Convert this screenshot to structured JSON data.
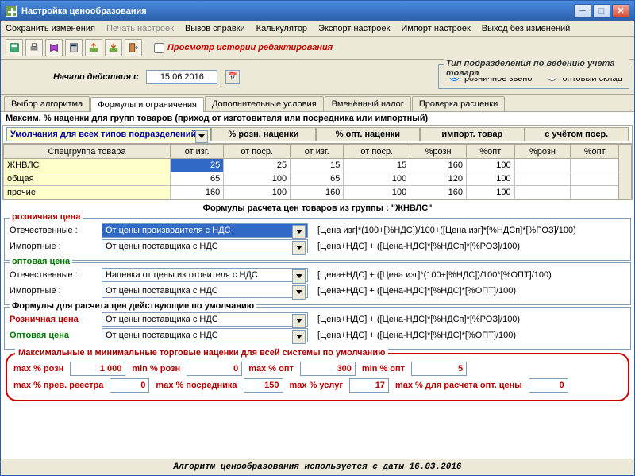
{
  "window": {
    "title": "Настройка ценообразования"
  },
  "menu": {
    "save": "Сохранить изменения",
    "print": "Печать настроек",
    "help": "Вызов справки",
    "calc": "Калькулятор",
    "export": "Экспорт настроек",
    "import": "Импорт настроек",
    "exit": "Выход без изменений"
  },
  "toolbar": {
    "history_label": "Просмотр истории редактирования"
  },
  "date": {
    "label": "Начало действия с",
    "value": "15.06.2016"
  },
  "dept_type": {
    "legend": "Тип подразделения по ведению учета товара",
    "retail": "розничное звено",
    "wholesale": "оптовый склад"
  },
  "tabs": {
    "t1": "Выбор алгоритма",
    "t2": "Формулы и ограничения",
    "t3": "Дополнительные условия",
    "t4": "Вменённый налог",
    "t5": "Проверка расценки"
  },
  "group_head": "Максим. % наценки для групп товаров (приход от изготовителя или посредника или импортный)",
  "combo_default": "Умолчания для всех типов подразделений",
  "hdr": {
    "retail_markup": "% розн. наценки",
    "wholesale_markup": "% опт. наценки",
    "import": "импорт. товар",
    "with_intermed": "с учётом поср."
  },
  "cols": {
    "c0": "Спецгруппа товара",
    "c1": "от изг.",
    "c2": "от поср.",
    "c3": "от изг.",
    "c4": "от поср.",
    "c5": "%розн",
    "c6": "%опт",
    "c7": "%розн",
    "c8": "%опт"
  },
  "rows": [
    {
      "name": "ЖНВЛС",
      "v1": "25",
      "v2": "25",
      "v3": "15",
      "v4": "15",
      "v5": "160",
      "v6": "100",
      "v7": "",
      "v8": ""
    },
    {
      "name": "общая",
      "v1": "65",
      "v2": "100",
      "v3": "65",
      "v4": "100",
      "v5": "120",
      "v6": "100",
      "v7": "",
      "v8": ""
    },
    {
      "name": "прочие",
      "v1": "160",
      "v2": "100",
      "v3": "160",
      "v4": "100",
      "v5": "160",
      "v6": "100",
      "v7": "",
      "v8": ""
    }
  ],
  "section_title": "Формулы расчета цен товаров из группы : \"ЖНВЛС\"",
  "retail_price": {
    "legend": "розничная цена",
    "dom_label": "Отечественные :",
    "dom_combo": "От цены производителя с НДС",
    "dom_formula": "[Цена изг]*(100+[%НДС])/100+([Цена изг]*[%НДСп]*[%РОЗ]/100)",
    "imp_label": "Импортные :",
    "imp_combo": "От цены поставщика с НДС",
    "imp_formula": "[Цена+НДС] + ([Цена-НДС]*[%НДСп]*[%РОЗ]/100)"
  },
  "wholesale_price": {
    "legend": "оптовая цена",
    "dom_label": "Отечественные :",
    "dom_combo": "Наценка от цены изготовителя с НДС",
    "dom_formula": "[Цена+НДС] + ([Цена изг]*(100+[%НДС])/100*[%ОПТ]/100)",
    "imp_label": "Импортные :",
    "imp_combo": "От цены поставщика с НДС",
    "imp_formula": "[Цена+НДС] + ([Цена-НДС]*[%НДС]*[%ОПТ]/100)"
  },
  "default_formulas": {
    "legend": "Формулы для расчета цен действующие по умолчанию",
    "rlabel": "Розничная цена",
    "rcombo": "От цены поставщика с НДС",
    "rform": "[Цена+НДС] + ([Цена-НДС]*[%НДСп]*[%РОЗ]/100)",
    "wlabel": "Оптовая цена",
    "wcombo": "От цены поставщика с НДС",
    "wform": "[Цена+НДС] + ([Цена-НДС]*[%НДС]*[%ОПТ]/100)"
  },
  "defaults": {
    "legend": "Максимальные и минимальные торговые наценки для всей системы  по умолчанию",
    "max_rozn_l": "max % розн",
    "max_rozn": "1 000",
    "min_rozn_l": "min % розн",
    "min_rozn": "0",
    "max_opt_l": "max % опт",
    "max_opt": "300",
    "min_opt_l": "min % опт",
    "min_opt": "5",
    "max_reestr_l": "max % прев. реестра",
    "max_reestr": "0",
    "max_posr_l": "max % посредника",
    "max_posr": "150",
    "max_uslug_l": "max % услуг",
    "max_uslug": "17",
    "max_calc_l": "max % для расчета опт. цены",
    "max_calc": "0"
  },
  "footer": "Алгоритм ценообразования используется с даты 16.03.2016"
}
